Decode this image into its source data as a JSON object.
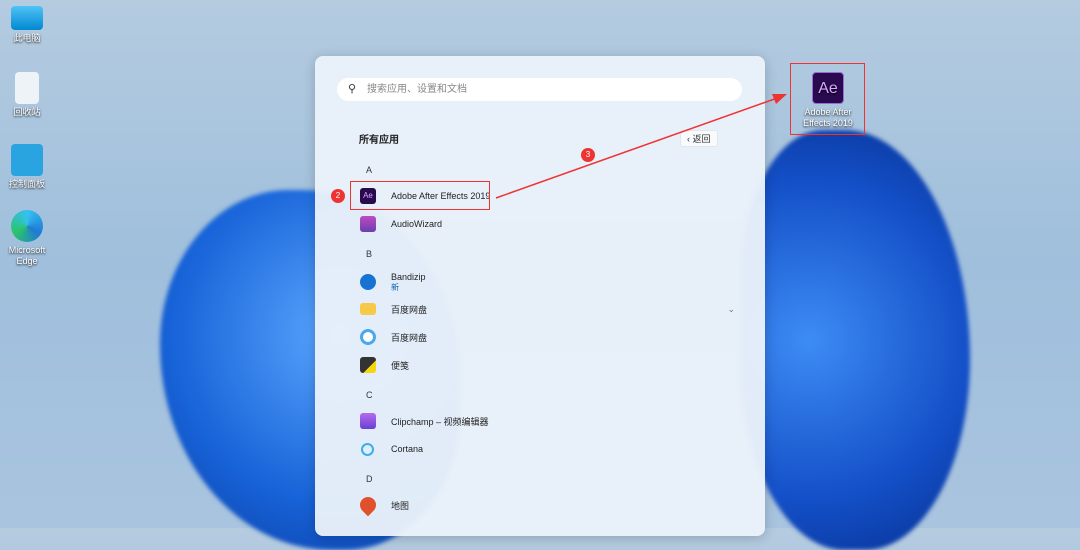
{
  "desktop": [
    {
      "label": "此电脑"
    },
    {
      "label": "回收站"
    },
    {
      "label": "控制面板"
    },
    {
      "label": "Microsoft Edge"
    },
    {
      "label": "Adobe After Effects 2019",
      "icon_text": "Ae"
    }
  ],
  "start": {
    "search_placeholder": "搜索应用、设置和文档",
    "header": "所有应用",
    "back": "返回",
    "sections": [
      {
        "letter": "A",
        "items": [
          {
            "label": "Adobe After Effects 2019",
            "icon_text": "Ae"
          },
          {
            "label": "AudioWizard"
          }
        ]
      },
      {
        "letter": "B",
        "items": [
          {
            "label": "Bandizip",
            "sub": "新"
          },
          {
            "label": "百度网盘",
            "expand": "⌄"
          },
          {
            "label": "百度网盘"
          },
          {
            "label": "便笺"
          }
        ]
      },
      {
        "letter": "C",
        "items": [
          {
            "label": "Clipchamp – 视频编辑器"
          },
          {
            "label": "Cortana"
          }
        ]
      },
      {
        "letter": "D",
        "items": [
          {
            "label": "地图"
          }
        ]
      }
    ]
  },
  "annotations": {
    "badge2": "2",
    "badge3": "3"
  },
  "colors": {
    "annotation": "#e33333",
    "ae": "#2a0a4f"
  }
}
